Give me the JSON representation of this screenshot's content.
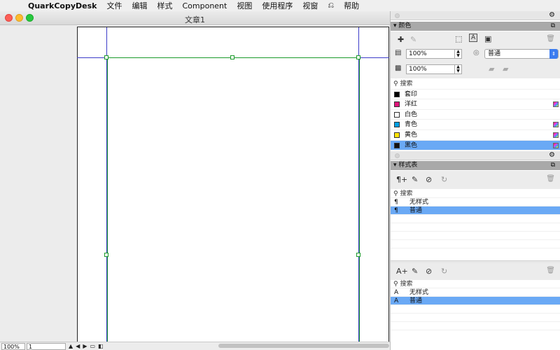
{
  "menubar": {
    "apple_icon": "apple-icon",
    "app_name": "QuarkCopyDesk",
    "items": [
      "文件",
      "编辑",
      "样式",
      "Component",
      "视图",
      "使用程序",
      "视窗",
      "⎌",
      "帮助"
    ]
  },
  "document": {
    "title": "文章1",
    "zoom": "100%",
    "page_number": "1"
  },
  "colors_palette": {
    "title": "颜色",
    "shade_value": "100%",
    "opacity_value": "100%",
    "blend_mode": "普通",
    "search_placeholder": "搜索",
    "items": [
      {
        "name": "套印",
        "swatch": "#000000",
        "spot": false
      },
      {
        "name": "洋红",
        "swatch": "#e0157a",
        "spot": true
      },
      {
        "name": "白色",
        "swatch": "#ffffff",
        "spot": false
      },
      {
        "name": "青色",
        "swatch": "#00a0e3",
        "spot": true
      },
      {
        "name": "黄色",
        "swatch": "#ffe500",
        "spot": true
      },
      {
        "name": "黑色",
        "swatch": "#111111",
        "spot": true
      }
    ],
    "selected": "黑色"
  },
  "style_sheets_palette": {
    "title": "样式表",
    "paragraph": {
      "search_placeholder": "搜索",
      "items": [
        "无样式",
        "普通"
      ],
      "selected": "普通",
      "glyph": "¶"
    },
    "character": {
      "search_placeholder": "搜索",
      "items": [
        "无样式",
        "普通"
      ],
      "selected": "普通",
      "glyph": "A"
    }
  },
  "accent_colors": {
    "selection": "#6aa9f5",
    "guides": "#3c3cc8",
    "box": "#1a9a2a"
  }
}
